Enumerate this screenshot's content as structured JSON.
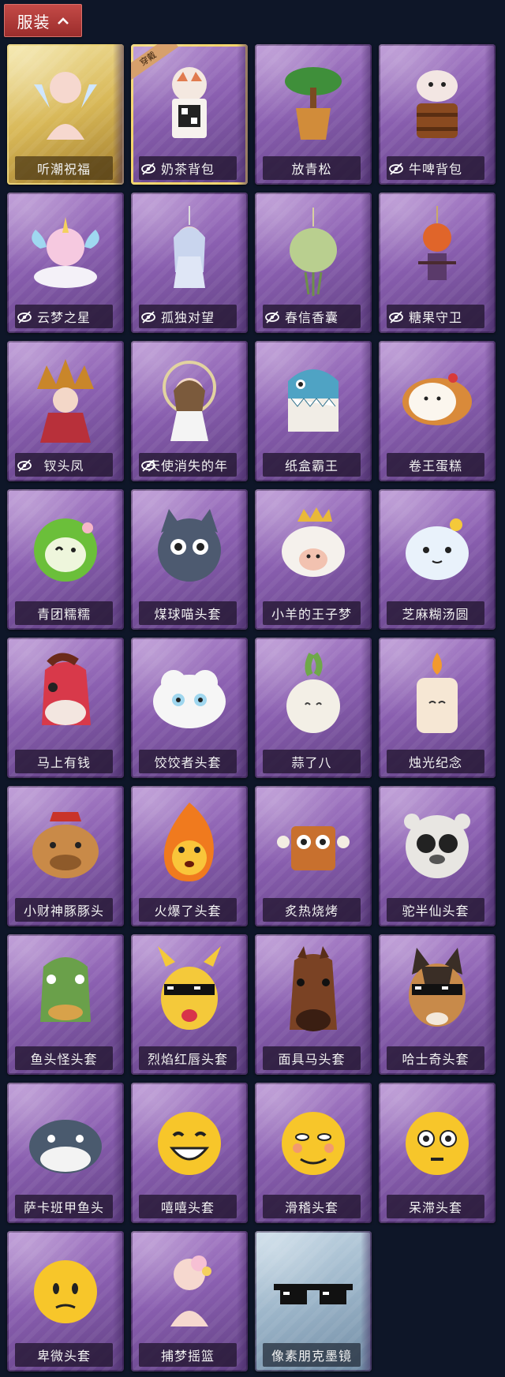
{
  "header": {
    "label": "服装"
  },
  "colors": {
    "header_bg": "#b13a38",
    "card_purple": "#8a5fb0",
    "card_gold": "#d8b858",
    "background": "#0e1628"
  },
  "items": [
    {
      "name": "听潮祝福",
      "icon": "silhouette-wings",
      "tier": "gold",
      "hidden_icon": false,
      "equipped": false
    },
    {
      "name": "奶茶背包",
      "icon": "milk-tea-backpack",
      "tier": "purple",
      "hidden_icon": true,
      "equipped": true,
      "worn_tag": "穿戴"
    },
    {
      "name": "放青松",
      "icon": "pine-pot",
      "tier": "purple",
      "hidden_icon": false,
      "equipped": false
    },
    {
      "name": "牛啤背包",
      "icon": "cow-barrel",
      "tier": "purple",
      "hidden_icon": true,
      "equipped": false
    },
    {
      "name": "云梦之星",
      "icon": "unicorn-cloud",
      "tier": "purple",
      "hidden_icon": true,
      "equipped": false
    },
    {
      "name": "孤独对望",
      "icon": "doll-charm",
      "tier": "purple",
      "hidden_icon": true,
      "equipped": false
    },
    {
      "name": "春信香囊",
      "icon": "sachet",
      "tier": "purple",
      "hidden_icon": true,
      "equipped": false
    },
    {
      "name": "糖果守卫",
      "icon": "pumpkin-charm",
      "tier": "purple",
      "hidden_icon": true,
      "equipped": false
    },
    {
      "name": "钗头凤",
      "icon": "phoenix-crown",
      "tier": "purple",
      "hidden_icon": true,
      "equipped": false
    },
    {
      "name": "天使消失的年",
      "icon": "angel-doll",
      "tier": "purple",
      "hidden_icon": true,
      "equipped": false
    },
    {
      "name": "纸盒霸王",
      "icon": "box-shark",
      "tier": "purple",
      "hidden_icon": false,
      "equipped": false
    },
    {
      "name": "卷王蛋糕",
      "icon": "roll-cake",
      "tier": "purple",
      "hidden_icon": false,
      "equipped": false
    },
    {
      "name": "青团糯糯",
      "icon": "green-dumpling",
      "tier": "purple",
      "hidden_icon": false,
      "equipped": false
    },
    {
      "name": "煤球喵头套",
      "icon": "black-cat",
      "tier": "purple",
      "hidden_icon": false,
      "equipped": false
    },
    {
      "name": "小羊的王子梦",
      "icon": "sheep-crown",
      "tier": "purple",
      "hidden_icon": false,
      "equipped": false
    },
    {
      "name": "芝麻糊汤圆",
      "icon": "rice-ball",
      "tier": "purple",
      "hidden_icon": false,
      "equipped": false
    },
    {
      "name": "马上有钱",
      "icon": "red-horse",
      "tier": "purple",
      "hidden_icon": false,
      "equipped": false
    },
    {
      "name": "饺饺者头套",
      "icon": "dumpling-cloud",
      "tier": "purple",
      "hidden_icon": false,
      "equipped": false
    },
    {
      "name": "蒜了八",
      "icon": "garlic",
      "tier": "purple",
      "hidden_icon": false,
      "equipped": false
    },
    {
      "name": "烛光纪念",
      "icon": "candle",
      "tier": "purple",
      "hidden_icon": false,
      "equipped": false
    },
    {
      "name": "小财神豚豚头",
      "icon": "capybara",
      "tier": "purple",
      "hidden_icon": false,
      "equipped": false
    },
    {
      "name": "火爆了头套",
      "icon": "fire-face",
      "tier": "purple",
      "hidden_icon": false,
      "equipped": false
    },
    {
      "name": "炙热烧烤",
      "icon": "meat-bone",
      "tier": "purple",
      "hidden_icon": false,
      "equipped": false
    },
    {
      "name": "驼半仙头套",
      "icon": "white-bear-glasses",
      "tier": "purple",
      "hidden_icon": false,
      "equipped": false
    },
    {
      "name": "鱼头怪头套",
      "icon": "fish-head",
      "tier": "purple",
      "hidden_icon": false,
      "equipped": false
    },
    {
      "name": "烈焰红唇头套",
      "icon": "yellow-mouse-glasses",
      "tier": "purple",
      "hidden_icon": false,
      "equipped": false
    },
    {
      "name": "面具马头套",
      "icon": "horse-mask",
      "tier": "purple",
      "hidden_icon": false,
      "equipped": false
    },
    {
      "name": "哈士奇头套",
      "icon": "husky-glasses",
      "tier": "purple",
      "hidden_icon": false,
      "equipped": false
    },
    {
      "name": "萨卡班甲鱼头",
      "icon": "fish-gray",
      "tier": "purple",
      "hidden_icon": false,
      "equipped": false
    },
    {
      "name": "嘻嘻头套",
      "icon": "grin-emoji",
      "tier": "purple",
      "hidden_icon": false,
      "equipped": false
    },
    {
      "name": "滑稽头套",
      "icon": "smirk-emoji",
      "tier": "purple",
      "hidden_icon": false,
      "equipped": false
    },
    {
      "name": "呆滞头套",
      "icon": "dazed-emoji",
      "tier": "purple",
      "hidden_icon": false,
      "equipped": false
    },
    {
      "name": "卑微头套",
      "icon": "humble-emoji",
      "tier": "purple",
      "hidden_icon": false,
      "equipped": false
    },
    {
      "name": "捕梦摇篮",
      "icon": "silhouette-flower",
      "tier": "purple",
      "hidden_icon": false,
      "equipped": false
    },
    {
      "name": "像素朋克墨镜",
      "icon": "pixel-sunglasses",
      "tier": "silver",
      "hidden_icon": false,
      "equipped": false
    }
  ]
}
